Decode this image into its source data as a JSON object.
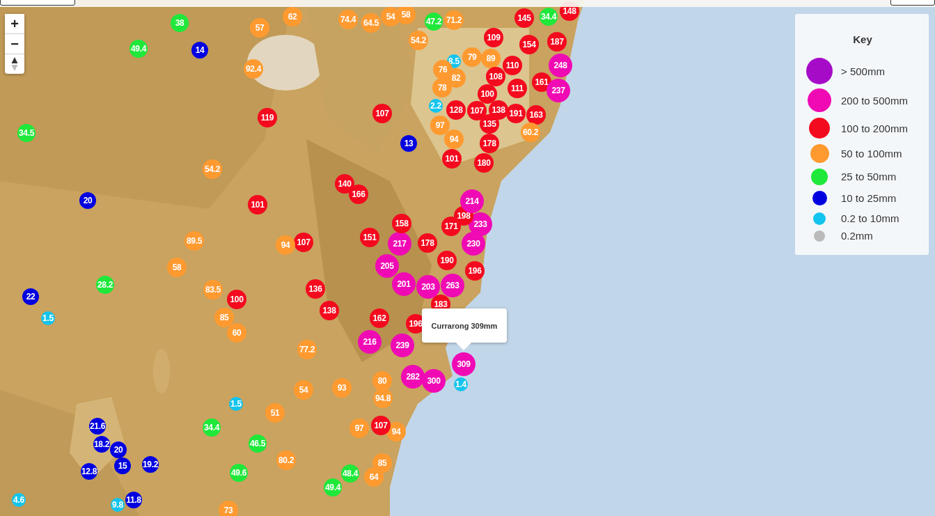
{
  "zoom_controls": {
    "zoom_in": "+",
    "zoom_out": "−"
  },
  "markers": [
    {
      "value": "38",
      "color": "#1fe83a"
    },
    {
      "value": "49.4",
      "color": "#1fe83a"
    },
    {
      "value": "14",
      "color": "#0000e0"
    },
    {
      "value": "57",
      "color": "#ff9a30"
    },
    {
      "value": "62",
      "color": "#ff9a30"
    },
    {
      "value": "92.4",
      "color": "#ff9a30"
    },
    {
      "value": "119",
      "color": "#f40a1e"
    },
    {
      "value": "34.5",
      "color": "#1fe83a"
    },
    {
      "value": "54.2",
      "color": "#ff9a30"
    },
    {
      "value": "20",
      "color": "#0000e0"
    },
    {
      "value": "101",
      "color": "#f40a1e"
    },
    {
      "value": "89.5",
      "color": "#ff9a30"
    },
    {
      "value": "107",
      "color": "#f40a1e"
    },
    {
      "value": "94",
      "color": "#ff9a30"
    },
    {
      "value": "58",
      "color": "#ff9a30"
    },
    {
      "value": "28.2",
      "color": "#1fe83a"
    },
    {
      "value": "22",
      "color": "#0000e0"
    },
    {
      "value": "1.5",
      "color": "#13c4ee"
    },
    {
      "value": "83.5",
      "color": "#ff9a30"
    },
    {
      "value": "85",
      "color": "#ff9a30"
    },
    {
      "value": "100",
      "color": "#f40a1e"
    },
    {
      "value": "60",
      "color": "#ff9a30"
    },
    {
      "value": "77.2",
      "color": "#ff9a30"
    },
    {
      "value": "54",
      "color": "#ff9a30"
    },
    {
      "value": "1.5",
      "color": "#13c4ee"
    },
    {
      "value": "51",
      "color": "#ff9a30"
    },
    {
      "value": "34.4",
      "color": "#1fe83a"
    },
    {
      "value": "46.5",
      "color": "#1fe83a"
    },
    {
      "value": "80.2",
      "color": "#ff9a30"
    },
    {
      "value": "49.6",
      "color": "#1fe83a"
    },
    {
      "value": "73",
      "color": "#ff9a30"
    },
    {
      "value": "21.6",
      "color": "#0000e0"
    },
    {
      "value": "18.2",
      "color": "#0000e0"
    },
    {
      "value": "20",
      "color": "#0000e0"
    },
    {
      "value": "15",
      "color": "#0000e0"
    },
    {
      "value": "19.2",
      "color": "#0000e0"
    },
    {
      "value": "12.8",
      "color": "#0000e0"
    },
    {
      "value": "4.6",
      "color": "#13c4ee"
    },
    {
      "value": "9.8",
      "color": "#13c4ee"
    },
    {
      "value": "11.8",
      "color": "#0000e0"
    },
    {
      "value": "136",
      "color": "#f40a1e"
    },
    {
      "value": "138",
      "color": "#f40a1e"
    },
    {
      "value": "93",
      "color": "#ff9a30"
    },
    {
      "value": "80",
      "color": "#ff9a30"
    },
    {
      "value": "94.8",
      "color": "#ff9a30"
    },
    {
      "value": "97",
      "color": "#ff9a30"
    },
    {
      "value": "94",
      "color": "#ff9a30"
    },
    {
      "value": "107",
      "color": "#f40a1e"
    },
    {
      "value": "85",
      "color": "#ff9a30"
    },
    {
      "value": "64",
      "color": "#ff9a30"
    },
    {
      "value": "48.4",
      "color": "#1fe83a"
    },
    {
      "value": "49.4",
      "color": "#1fe83a"
    },
    {
      "value": "216",
      "color": "#f00ab4"
    },
    {
      "value": "239",
      "color": "#f00ab4"
    },
    {
      "value": "162",
      "color": "#f40a1e"
    },
    {
      "value": "196",
      "color": "#f40a1e"
    },
    {
      "value": "309",
      "color": "#f00ab4"
    },
    {
      "value": "1.4",
      "color": "#13c4ee"
    },
    {
      "value": "282",
      "color": "#f00ab4"
    },
    {
      "value": "300",
      "color": "#f00ab4"
    },
    {
      "value": "183",
      "color": "#f40a1e"
    },
    {
      "value": "203",
      "color": "#f00ab4"
    },
    {
      "value": "263",
      "color": "#f00ab4"
    },
    {
      "value": "205",
      "color": "#f00ab4"
    },
    {
      "value": "201",
      "color": "#f00ab4"
    },
    {
      "value": "217",
      "color": "#f00ab4"
    },
    {
      "value": "178",
      "color": "#f40a1e"
    },
    {
      "value": "190",
      "color": "#f40a1e"
    },
    {
      "value": "230",
      "color": "#f00ab4"
    },
    {
      "value": "196",
      "color": "#f40a1e"
    },
    {
      "value": "171",
      "color": "#f40a1e"
    },
    {
      "value": "233",
      "color": "#f00ab4"
    },
    {
      "value": "198",
      "color": "#f40a1e"
    },
    {
      "value": "214",
      "color": "#f00ab4"
    },
    {
      "value": "151",
      "color": "#f40a1e"
    },
    {
      "value": "158",
      "color": "#f40a1e"
    },
    {
      "value": "140",
      "color": "#f40a1e"
    },
    {
      "value": "166",
      "color": "#f40a1e"
    },
    {
      "value": "74.4",
      "color": "#ff9a30"
    },
    {
      "value": "64.5",
      "color": "#ff9a30"
    },
    {
      "value": "54",
      "color": "#ff9a30"
    },
    {
      "value": "58",
      "color": "#ff9a30"
    },
    {
      "value": "47.2",
      "color": "#1fe83a"
    },
    {
      "value": "71.2",
      "color": "#ff9a30"
    },
    {
      "value": "54.2",
      "color": "#ff9a30"
    },
    {
      "value": "79",
      "color": "#ff9a30"
    },
    {
      "value": "8.5",
      "color": "#13c4ee"
    },
    {
      "value": "76",
      "color": "#ff9a30"
    },
    {
      "value": "82",
      "color": "#ff9a30"
    },
    {
      "value": "78",
      "color": "#ff9a30"
    },
    {
      "value": "2.2",
      "color": "#13c4ee"
    },
    {
      "value": "107",
      "color": "#f40a1e"
    },
    {
      "value": "128",
      "color": "#f40a1e"
    },
    {
      "value": "107",
      "color": "#f40a1e"
    },
    {
      "value": "138",
      "color": "#f40a1e"
    },
    {
      "value": "191",
      "color": "#f40a1e"
    },
    {
      "value": "163",
      "color": "#f40a1e"
    },
    {
      "value": "135",
      "color": "#f40a1e"
    },
    {
      "value": "178",
      "color": "#f40a1e"
    },
    {
      "value": "180",
      "color": "#f40a1e"
    },
    {
      "value": "101",
      "color": "#f40a1e"
    },
    {
      "value": "97",
      "color": "#ff9a30"
    },
    {
      "value": "94",
      "color": "#ff9a30"
    },
    {
      "value": "60.2",
      "color": "#ff9a30"
    },
    {
      "value": "13",
      "color": "#0000e0"
    },
    {
      "value": "34.4",
      "color": "#1fe83a"
    },
    {
      "value": "148",
      "color": "#f40a1e"
    },
    {
      "value": "145",
      "color": "#f40a1e"
    },
    {
      "value": "109",
      "color": "#f40a1e"
    },
    {
      "value": "154",
      "color": "#f40a1e"
    },
    {
      "value": "89",
      "color": "#ff9a30"
    },
    {
      "value": "110",
      "color": "#f40a1e"
    },
    {
      "value": "108",
      "color": "#f40a1e"
    },
    {
      "value": "100",
      "color": "#f40a1e"
    },
    {
      "value": "111",
      "color": "#f40a1e"
    },
    {
      "value": "161",
      "color": "#f40a1e"
    },
    {
      "value": "187",
      "color": "#f40a1e"
    },
    {
      "value": "248",
      "color": "#f00ab4"
    },
    {
      "value": "237",
      "color": "#f00ab4"
    }
  ],
  "tooltip": {
    "text": "Currarong 309mm"
  },
  "key": {
    "title": "Key",
    "items": [
      {
        "label": "> 500mm",
        "color": "#a60cc7"
      },
      {
        "label": "200 to 500mm",
        "color": "#f00ab4"
      },
      {
        "label": "100 to 200mm",
        "color": "#f40a1e"
      },
      {
        "label": "50 to 100mm",
        "color": "#ff9a30"
      },
      {
        "label": "25 to 50mm",
        "color": "#1fe83a"
      },
      {
        "label": "10 to 25mm",
        "color": "#0000e0"
      },
      {
        "label": "0.2 to 10mm",
        "color": "#13c4ee"
      },
      {
        "label": "0.2mm",
        "color": "#bbbbbb"
      }
    ]
  }
}
